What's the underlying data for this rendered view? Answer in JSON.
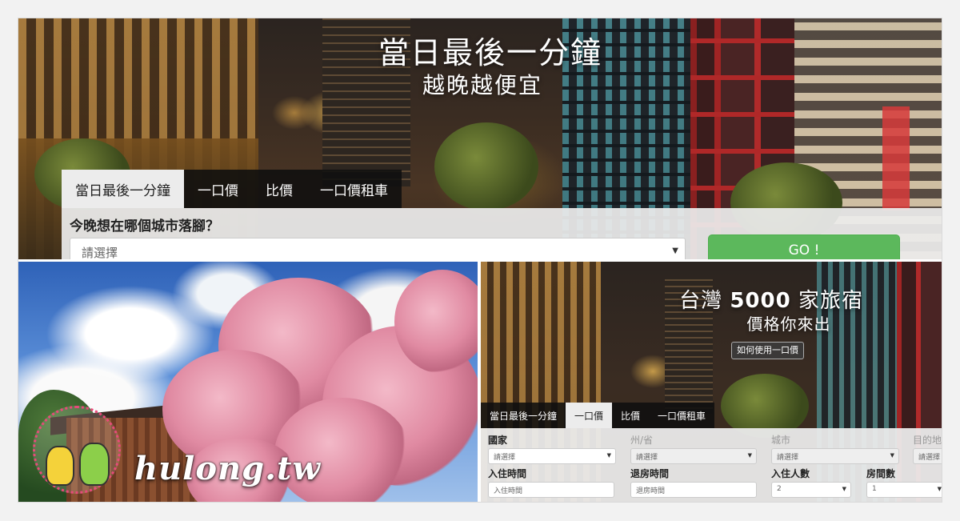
{
  "top_panel": {
    "title": "當日最後一分鐘",
    "subtitle": "越晚越便宜",
    "tabs": [
      "當日最後一分鐘",
      "一口價",
      "比價",
      "一口價租車"
    ],
    "active_tab": 0,
    "question": "今晚想在哪個城市落腳？",
    "city_select": {
      "value": "請選擇"
    },
    "go_button": "GO !"
  },
  "photo": {
    "watermark_text": "hulong.tw"
  },
  "bottom_panel": {
    "title_prefix": "台灣",
    "title_number": "5000",
    "title_suffix": "家旅宿",
    "subtitle": "價格你來出",
    "howto_button": "如何使用一口價",
    "tabs": [
      "當日最後一分鐘",
      "一口價",
      "比價",
      "一口價租車"
    ],
    "active_tab": 1,
    "form": {
      "country_label": "國家",
      "country_value": "請選擇",
      "state_label": "州/省",
      "state_value": "請選擇",
      "city_label": "城市",
      "city_value": "請選擇",
      "destination_label": "目的地",
      "destination_value": "請選擇",
      "checkin_label": "入住時間",
      "checkin_placeholder": "入住時間",
      "checkout_label": "退房時間",
      "checkout_placeholder": "退房時間",
      "guests_label": "入住人數",
      "guests_value": "2",
      "rooms_label": "房間數",
      "rooms_value": "1"
    }
  },
  "colors": {
    "go_button": "#5cb85c",
    "tab_bar": "#0f0f0f",
    "active_tab": "#ececec"
  }
}
